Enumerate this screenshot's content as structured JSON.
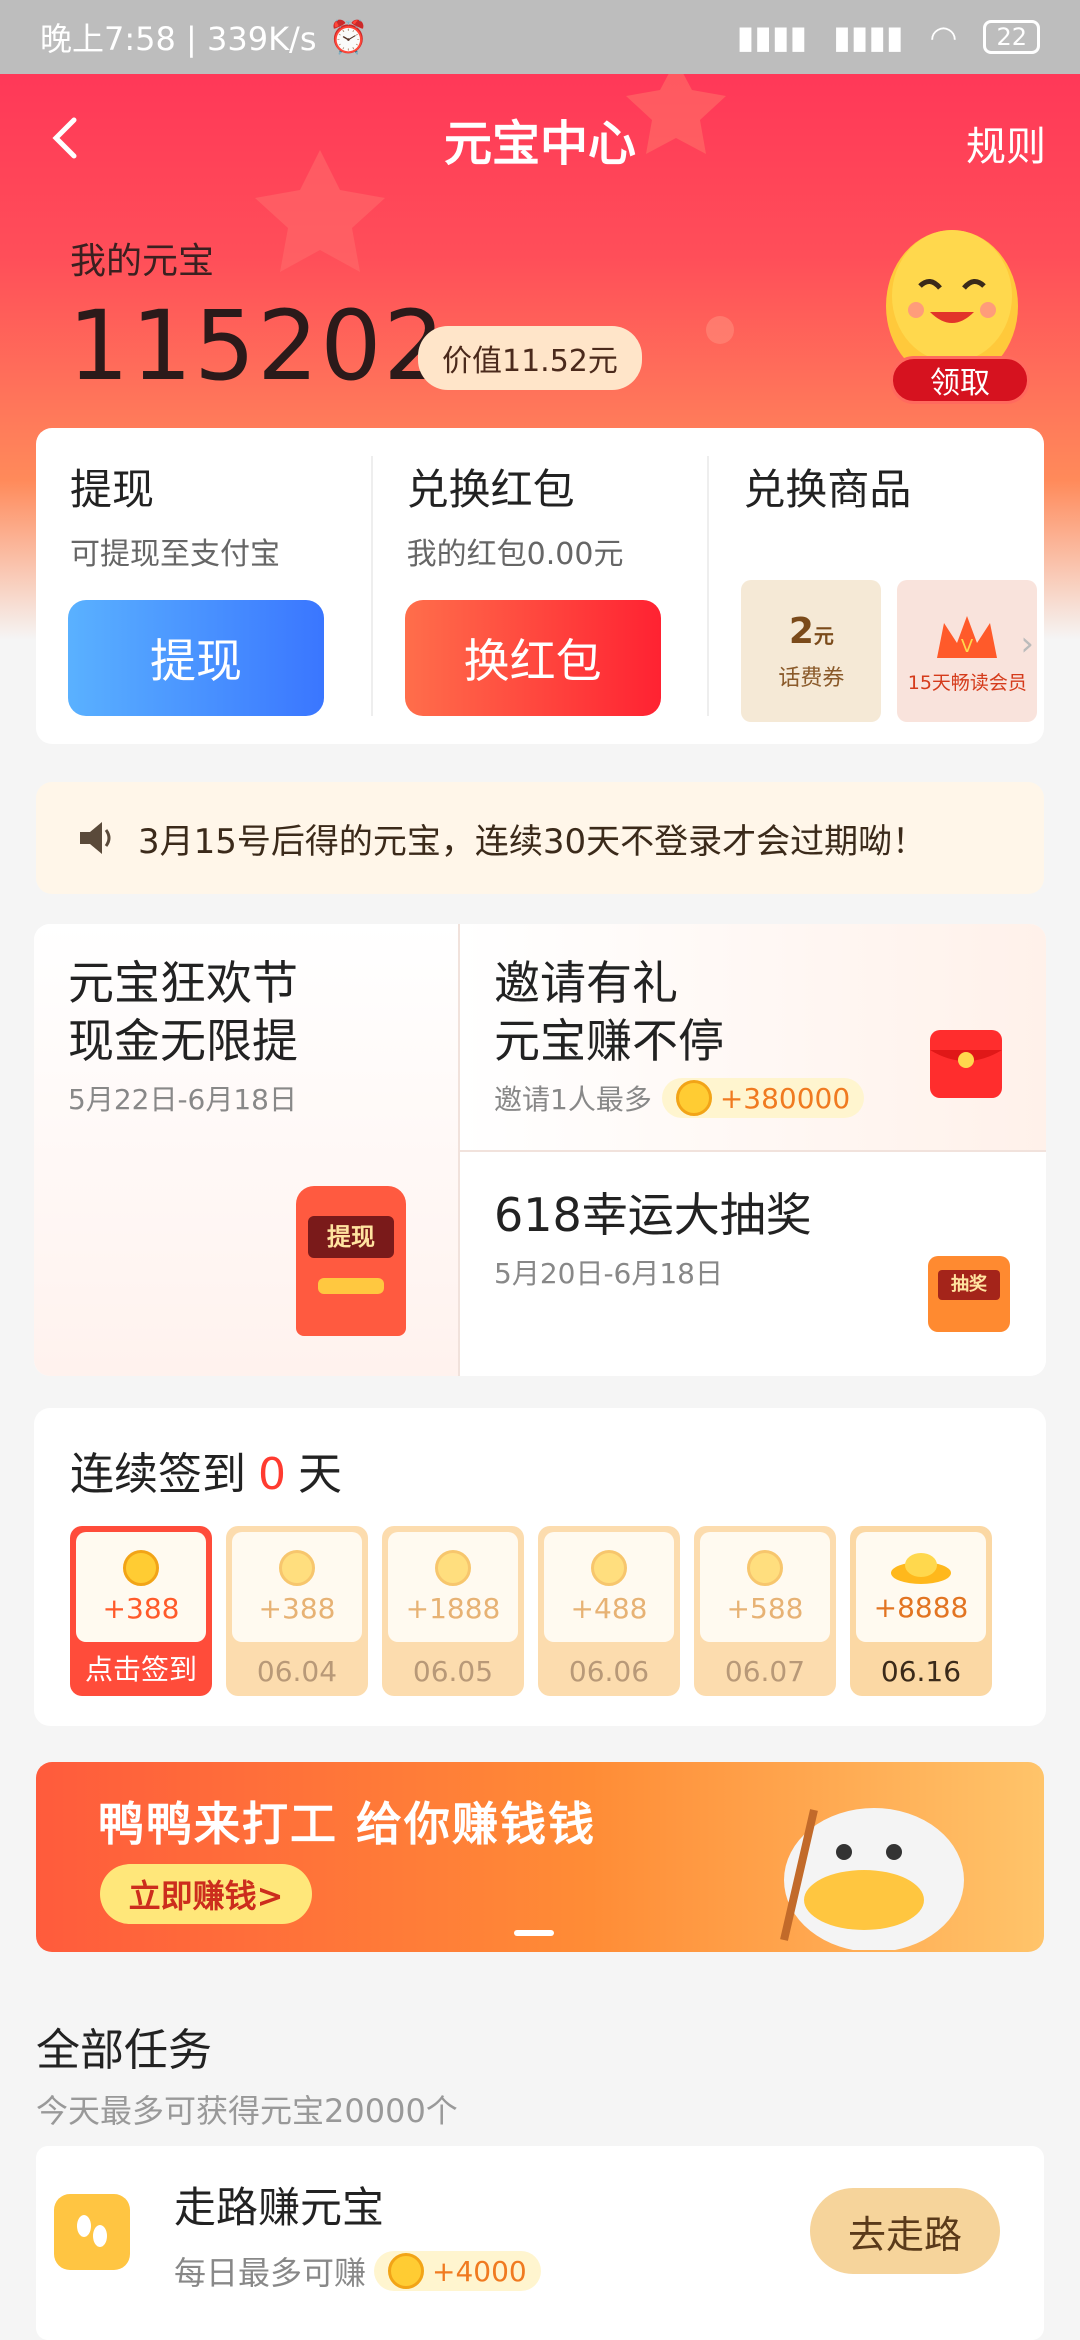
{
  "status_bar": {
    "time": "晚上7:58 | 339K/s",
    "battery": "22"
  },
  "header": {
    "title": "元宝中心",
    "rules": "规则"
  },
  "account": {
    "label": "我的元宝",
    "balance": "115202",
    "worth": "价值11.52元",
    "claim": "领取"
  },
  "exchange": {
    "withdraw": {
      "title": "提现",
      "sub": "可提现至支付宝",
      "button": "提现"
    },
    "redpacket": {
      "title": "兑换红包",
      "sub": "我的红包0.00元",
      "button": "换红包"
    },
    "goods": {
      "title": "兑换商品",
      "items": [
        {
          "amount": "2",
          "unit": "元",
          "label": "话费券"
        },
        {
          "label": "15天畅读会员"
        }
      ]
    }
  },
  "notice": "3月15号后得的元宝，连续30天不登录才会过期呦！",
  "promos": {
    "carnival": {
      "line1": "元宝狂欢节",
      "line2": "现金无限提",
      "date": "5月22日-6月18日",
      "machine_text": "提现"
    },
    "invite": {
      "line1": "邀请有礼",
      "line2": "元宝赚不停",
      "note": "邀请1人最多",
      "reward": "+380000"
    },
    "lottery": {
      "title": "618幸运大抽奖",
      "date": "5月20日-6月18日",
      "box_text": "抽奖"
    }
  },
  "signin": {
    "prefix": "连续签到",
    "count": "0",
    "suffix": "天",
    "days": [
      {
        "amount": "+388",
        "label": "点击签到"
      },
      {
        "amount": "+388",
        "label": "06.04"
      },
      {
        "amount": "+1888",
        "label": "06.05"
      },
      {
        "amount": "+488",
        "label": "06.06"
      },
      {
        "amount": "+588",
        "label": "06.07"
      },
      {
        "amount": "+8888",
        "label": "06.16"
      }
    ]
  },
  "banner": {
    "title": "鸭鸭来打工 给你赚钱钱",
    "button": "立即赚钱>"
  },
  "tasks": {
    "title": "全部任务",
    "subtitle": "今天最多可获得元宝20000个",
    "items": [
      {
        "name": "走路赚元宝",
        "desc": "每日最多可赚",
        "reward": "+4000",
        "button": "去走路"
      }
    ]
  }
}
